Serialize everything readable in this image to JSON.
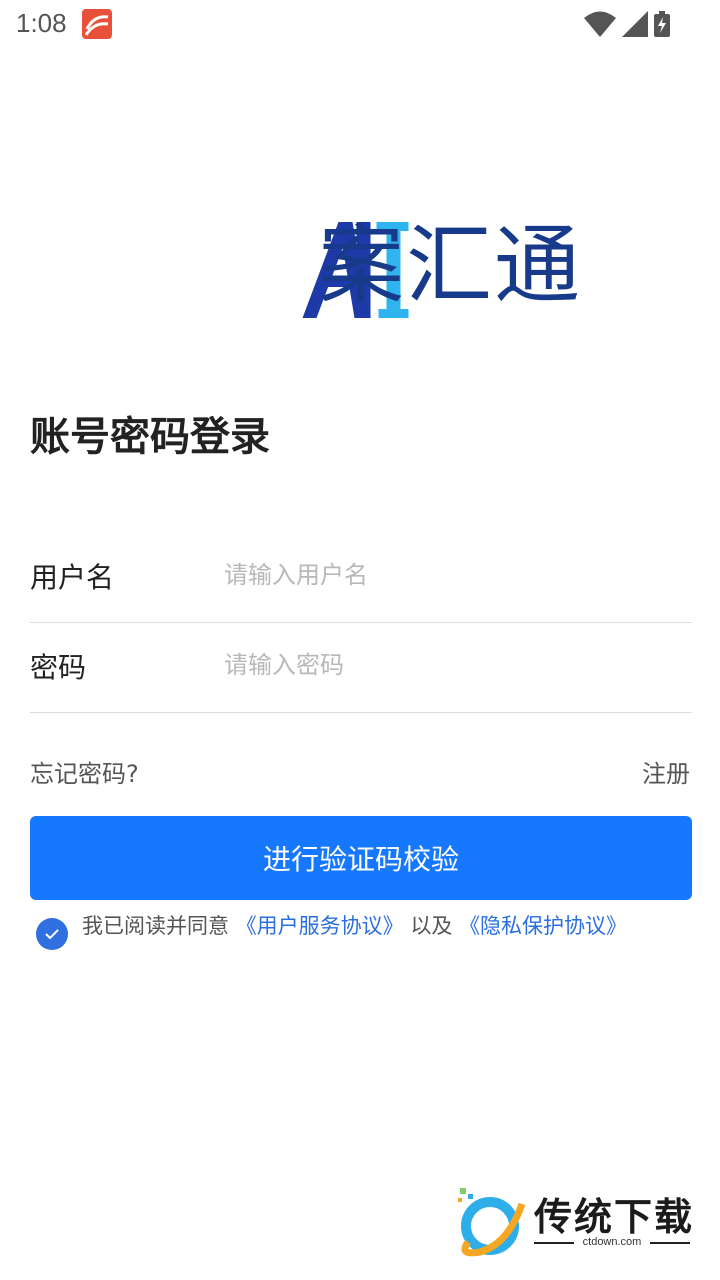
{
  "status_bar": {
    "time": "1:08",
    "app_icon": "news-app-icon",
    "icons": [
      "wifi-icon",
      "signal-icon",
      "battery-charging-icon"
    ]
  },
  "logo": {
    "text": "案汇通",
    "colors": {
      "blue": "#1e3aa8",
      "light_blue": "#2fb4f0",
      "text": "#173a8a"
    }
  },
  "login": {
    "title": "账号密码登录",
    "username": {
      "label": "用户名",
      "placeholder": "请输入用户名",
      "value": ""
    },
    "password": {
      "label": "密码",
      "placeholder": "请输入密码",
      "value": ""
    },
    "forgot_label": "忘记密码?",
    "register_label": "注册",
    "submit_label": "进行验证码校验",
    "agreement": {
      "checked": true,
      "prefix": "我已阅读并同意",
      "user_agreement": "《用户服务协议》",
      "separator": "以及",
      "privacy_policy": "《隐私保护协议》"
    }
  },
  "watermark": {
    "name": "传统下载",
    "url": "ctdown.com"
  },
  "colors": {
    "primary": "#1677ff",
    "link": "#2a6fe0",
    "divider": "#dcdcdc"
  }
}
